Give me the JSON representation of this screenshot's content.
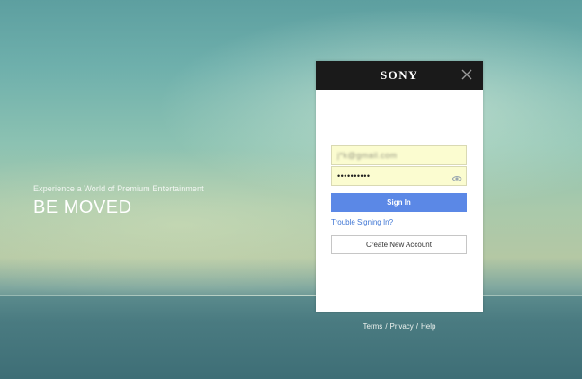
{
  "hero": {
    "tagline": "Experience a World of Premium Entertainment",
    "headline": "BE MOVED"
  },
  "login": {
    "brand": "SONY",
    "username_value": "j*k@gmail.com",
    "password_value": "••••••••••",
    "sign_in_label": "Sign In",
    "trouble_label": "Trouble Signing In?",
    "create_account_label": "Create New Account"
  },
  "footer": {
    "terms": "Terms",
    "privacy": "Privacy",
    "help": "Help",
    "separator": "/"
  },
  "colors": {
    "header": "#1a1a1a",
    "primary_button": "#5b88e6",
    "link": "#3f76d4",
    "autofill": "#fbfcd0"
  }
}
